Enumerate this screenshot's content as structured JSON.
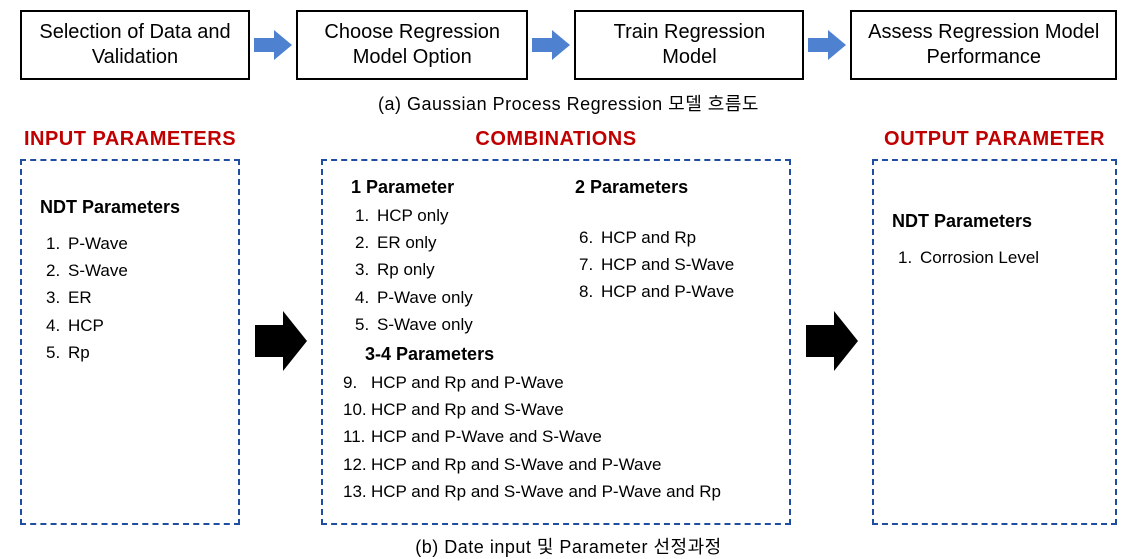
{
  "flow": {
    "steps": [
      "Selection of Data and Validation",
      "Choose Regression Model Option",
      "Train Regression Model",
      "Assess Regression Model Performance"
    ],
    "caption": "(a) Gaussian Process Regression 모델 흐름도"
  },
  "params": {
    "input": {
      "header": "INPUT PARAMETERS",
      "title": "NDT Parameters",
      "items": [
        "P-Wave",
        "S-Wave",
        "ER",
        "HCP",
        "Rp"
      ]
    },
    "combinations": {
      "header": "COMBINATIONS",
      "oneParam": {
        "title": "1 Parameter",
        "items": [
          "HCP only",
          "ER only",
          "Rp only",
          "P-Wave only",
          "S-Wave only"
        ]
      },
      "twoParam": {
        "title": "2 Parameters",
        "items": [
          "HCP and Rp",
          "HCP and S-Wave",
          "HCP and P-Wave"
        ]
      },
      "threeFour": {
        "title": "3-4 Parameters",
        "items": [
          "HCP and Rp and P-Wave",
          "HCP and Rp and S-Wave",
          "HCP and P-Wave and S-Wave",
          "HCP and Rp and S-Wave and P-Wave",
          "HCP and Rp and S-Wave and P-Wave and Rp"
        ]
      }
    },
    "output": {
      "header": "OUTPUT PARAMETER",
      "title": "NDT Parameters",
      "items": [
        "Corrosion Level"
      ]
    }
  },
  "captionBottom": "(b) Date input 및 Parameter 선정과정",
  "nums": {
    "n1": "1.",
    "n2": "2.",
    "n3": "3.",
    "n4": "4.",
    "n5": "5.",
    "n6": "6.",
    "n7": "7.",
    "n8": "8.",
    "n9": "9.",
    "n10": "10.",
    "n11": "11.",
    "n12": "12.",
    "n13": "13."
  }
}
